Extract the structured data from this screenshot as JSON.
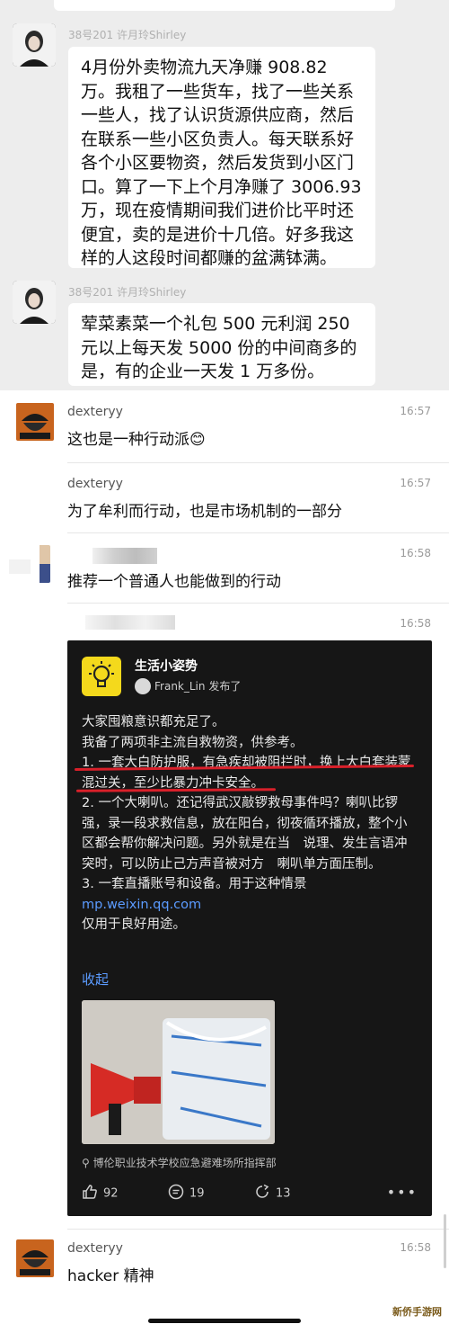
{
  "chat": {
    "top_strip_text": "",
    "messages": [
      {
        "sender": "38号201 许月玲Shirley",
        "text": "4月份外卖物流九天净赚 908.82 万。我租了一些货车，找了一些关系一些人，找了认识货源供应商，然后在联系一些小区负责人。每天联系好各个小区要物资，然后发货到小区门口。算了一下上个月净赚了 3006.93 万，现在疫情期间我们进价比平时还便宜，卖的是进价十几倍。好多我这样的人这段时间都赚的盆满钵满。"
      },
      {
        "sender": "38号201 许月玲Shirley",
        "text": "荤菜素菜一个礼包 500 元利润 250 元以上每天发 5000 份的中间商多的是，有的企业一天发 1 万多份。"
      }
    ]
  },
  "comments": [
    {
      "name": "dexteryy",
      "time": "16:57",
      "text": "这也是一种行动派😊"
    },
    {
      "name": "dexteryy",
      "time": "16:57",
      "text": "为了牟利而行动，也是市场机制的一部分"
    },
    {
      "name": "",
      "time": "16:58",
      "text": "推荐一个普通人也能做到的行动"
    },
    {
      "name": "",
      "time": "16:58",
      "text": ""
    },
    {
      "name": "dexteryy",
      "time": "16:58",
      "text": "hacker 精神"
    }
  ],
  "card": {
    "title": "生活小姿势",
    "author": "Frank_Lin",
    "published": "发布了",
    "body_lines": [
      "大家囤粮意识都充足了。",
      "我备了两项非主流自救物资，供参考。",
      "1. 一套大白防护服，有急疾却被阻拦时，换上大白套装蒙混过关，至少比暴力冲卡安全。",
      "2. 一个大喇叭。还记得武汉敲锣救母事件吗？喇叭比锣强，录一段求救信息，放在阳台，彻夜循环播放，整个小区都会帮你解决问题。另外就是在当　说理、发生言语冲突时，可以防止己方声音被对方　喇叭单方面压制。",
      "3. 一套直播账号和设备。用于这种情景"
    ],
    "link": "mp.weixin.qq.com",
    "after_link": "仅用于良好用途。",
    "collapse": "收起",
    "location": "博伦职业技术学校应急避难场所指挥部",
    "likes": "92",
    "comments": "19",
    "shares": "13"
  },
  "watermark": "新侨手游网",
  "colors": {
    "chat_bg": "#ededed",
    "card_bg": "#161616",
    "link": "#5b9bff",
    "underline": "#d9202a",
    "logo_yellow": "#f4d91c"
  },
  "icons": [
    "avatar-photo-icon",
    "pirate-avatar-icon",
    "lightbulb-icon",
    "user-icon",
    "location-pin-icon",
    "thumb-up-icon",
    "comment-icon",
    "share-icon",
    "more-icon"
  ]
}
